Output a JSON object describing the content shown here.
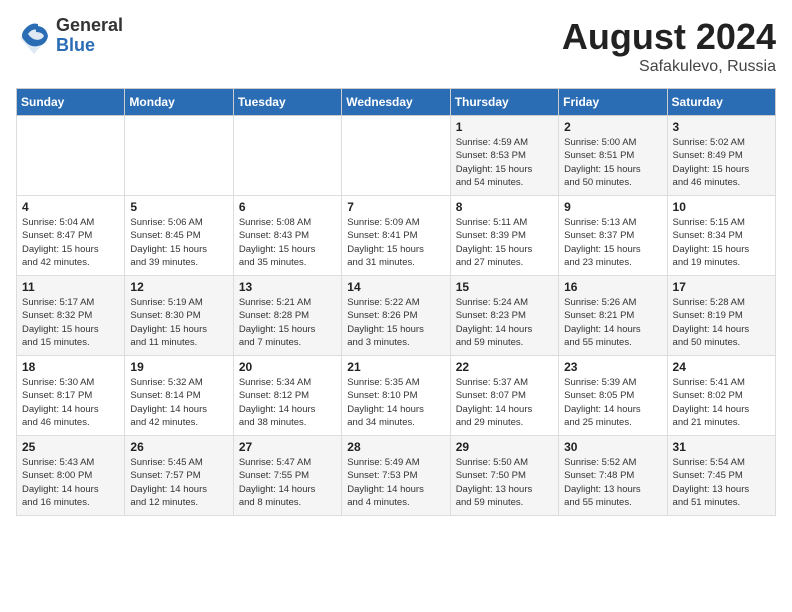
{
  "header": {
    "logo_general": "General",
    "logo_blue": "Blue",
    "month_year": "August 2024",
    "location": "Safakulevo, Russia"
  },
  "days_of_week": [
    "Sunday",
    "Monday",
    "Tuesday",
    "Wednesday",
    "Thursday",
    "Friday",
    "Saturday"
  ],
  "weeks": [
    [
      {
        "day": "",
        "info": ""
      },
      {
        "day": "",
        "info": ""
      },
      {
        "day": "",
        "info": ""
      },
      {
        "day": "",
        "info": ""
      },
      {
        "day": "1",
        "info": "Sunrise: 4:59 AM\nSunset: 8:53 PM\nDaylight: 15 hours\nand 54 minutes."
      },
      {
        "day": "2",
        "info": "Sunrise: 5:00 AM\nSunset: 8:51 PM\nDaylight: 15 hours\nand 50 minutes."
      },
      {
        "day": "3",
        "info": "Sunrise: 5:02 AM\nSunset: 8:49 PM\nDaylight: 15 hours\nand 46 minutes."
      }
    ],
    [
      {
        "day": "4",
        "info": "Sunrise: 5:04 AM\nSunset: 8:47 PM\nDaylight: 15 hours\nand 42 minutes."
      },
      {
        "day": "5",
        "info": "Sunrise: 5:06 AM\nSunset: 8:45 PM\nDaylight: 15 hours\nand 39 minutes."
      },
      {
        "day": "6",
        "info": "Sunrise: 5:08 AM\nSunset: 8:43 PM\nDaylight: 15 hours\nand 35 minutes."
      },
      {
        "day": "7",
        "info": "Sunrise: 5:09 AM\nSunset: 8:41 PM\nDaylight: 15 hours\nand 31 minutes."
      },
      {
        "day": "8",
        "info": "Sunrise: 5:11 AM\nSunset: 8:39 PM\nDaylight: 15 hours\nand 27 minutes."
      },
      {
        "day": "9",
        "info": "Sunrise: 5:13 AM\nSunset: 8:37 PM\nDaylight: 15 hours\nand 23 minutes."
      },
      {
        "day": "10",
        "info": "Sunrise: 5:15 AM\nSunset: 8:34 PM\nDaylight: 15 hours\nand 19 minutes."
      }
    ],
    [
      {
        "day": "11",
        "info": "Sunrise: 5:17 AM\nSunset: 8:32 PM\nDaylight: 15 hours\nand 15 minutes."
      },
      {
        "day": "12",
        "info": "Sunrise: 5:19 AM\nSunset: 8:30 PM\nDaylight: 15 hours\nand 11 minutes."
      },
      {
        "day": "13",
        "info": "Sunrise: 5:21 AM\nSunset: 8:28 PM\nDaylight: 15 hours\nand 7 minutes."
      },
      {
        "day": "14",
        "info": "Sunrise: 5:22 AM\nSunset: 8:26 PM\nDaylight: 15 hours\nand 3 minutes."
      },
      {
        "day": "15",
        "info": "Sunrise: 5:24 AM\nSunset: 8:23 PM\nDaylight: 14 hours\nand 59 minutes."
      },
      {
        "day": "16",
        "info": "Sunrise: 5:26 AM\nSunset: 8:21 PM\nDaylight: 14 hours\nand 55 minutes."
      },
      {
        "day": "17",
        "info": "Sunrise: 5:28 AM\nSunset: 8:19 PM\nDaylight: 14 hours\nand 50 minutes."
      }
    ],
    [
      {
        "day": "18",
        "info": "Sunrise: 5:30 AM\nSunset: 8:17 PM\nDaylight: 14 hours\nand 46 minutes."
      },
      {
        "day": "19",
        "info": "Sunrise: 5:32 AM\nSunset: 8:14 PM\nDaylight: 14 hours\nand 42 minutes."
      },
      {
        "day": "20",
        "info": "Sunrise: 5:34 AM\nSunset: 8:12 PM\nDaylight: 14 hours\nand 38 minutes."
      },
      {
        "day": "21",
        "info": "Sunrise: 5:35 AM\nSunset: 8:10 PM\nDaylight: 14 hours\nand 34 minutes."
      },
      {
        "day": "22",
        "info": "Sunrise: 5:37 AM\nSunset: 8:07 PM\nDaylight: 14 hours\nand 29 minutes."
      },
      {
        "day": "23",
        "info": "Sunrise: 5:39 AM\nSunset: 8:05 PM\nDaylight: 14 hours\nand 25 minutes."
      },
      {
        "day": "24",
        "info": "Sunrise: 5:41 AM\nSunset: 8:02 PM\nDaylight: 14 hours\nand 21 minutes."
      }
    ],
    [
      {
        "day": "25",
        "info": "Sunrise: 5:43 AM\nSunset: 8:00 PM\nDaylight: 14 hours\nand 16 minutes."
      },
      {
        "day": "26",
        "info": "Sunrise: 5:45 AM\nSunset: 7:57 PM\nDaylight: 14 hours\nand 12 minutes."
      },
      {
        "day": "27",
        "info": "Sunrise: 5:47 AM\nSunset: 7:55 PM\nDaylight: 14 hours\nand 8 minutes."
      },
      {
        "day": "28",
        "info": "Sunrise: 5:49 AM\nSunset: 7:53 PM\nDaylight: 14 hours\nand 4 minutes."
      },
      {
        "day": "29",
        "info": "Sunrise: 5:50 AM\nSunset: 7:50 PM\nDaylight: 13 hours\nand 59 minutes."
      },
      {
        "day": "30",
        "info": "Sunrise: 5:52 AM\nSunset: 7:48 PM\nDaylight: 13 hours\nand 55 minutes."
      },
      {
        "day": "31",
        "info": "Sunrise: 5:54 AM\nSunset: 7:45 PM\nDaylight: 13 hours\nand 51 minutes."
      }
    ]
  ]
}
